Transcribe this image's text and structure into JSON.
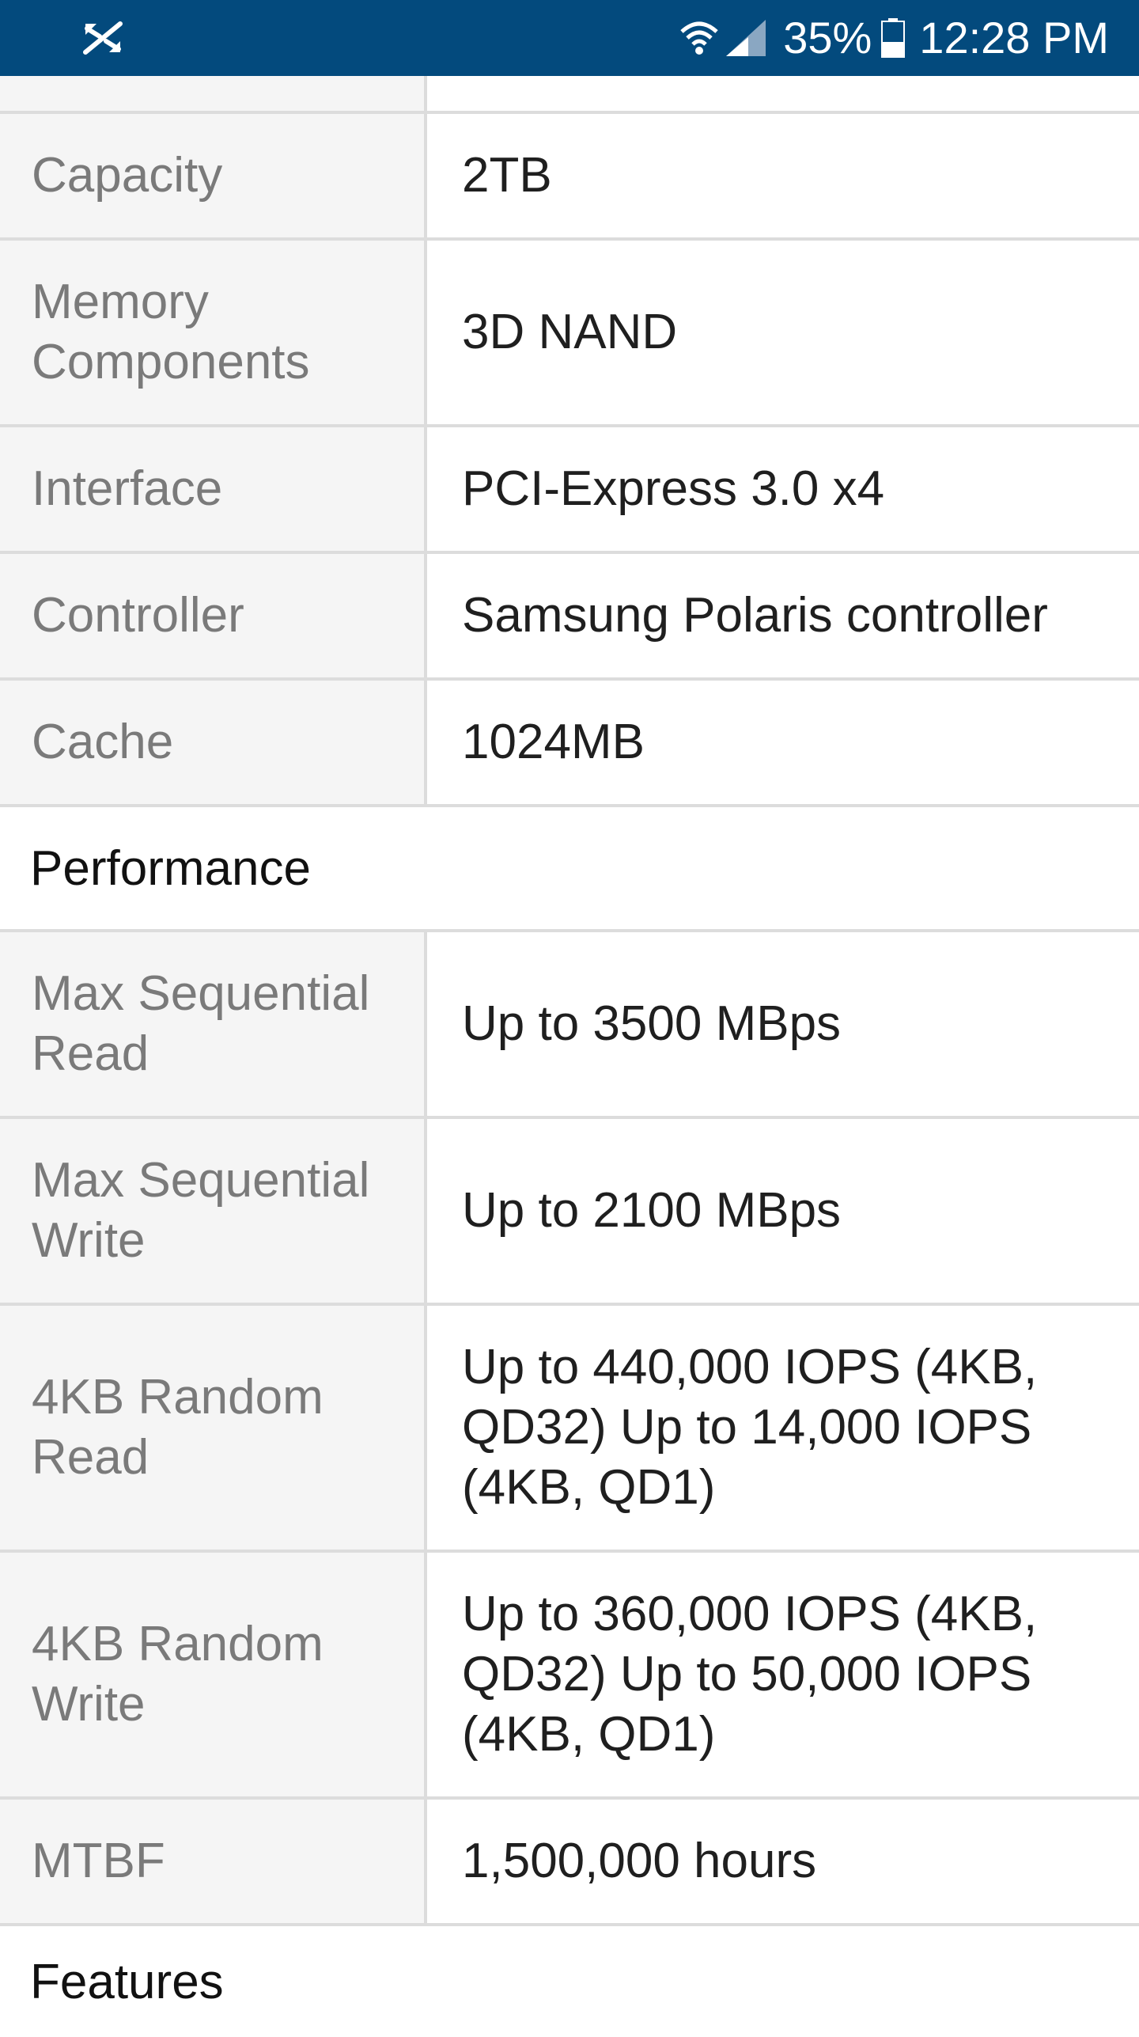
{
  "status_bar": {
    "battery_percent": "35%",
    "time": "12:28 PM",
    "icons": [
      "mute-sync-icon",
      "wifi-icon",
      "signal-icon",
      "battery-icon"
    ],
    "background": "#034a7d"
  },
  "specs": {
    "rows_group1": [
      {
        "label": "Capacity",
        "value": "2TB"
      },
      {
        "label": "Memory Components",
        "value": "3D NAND"
      },
      {
        "label": "Interface",
        "value": "PCI-Express 3.0 x4"
      },
      {
        "label": "Controller",
        "value": "Samsung Polaris controller"
      },
      {
        "label": "Cache",
        "value": "1024MB"
      }
    ],
    "section_performance": "Performance",
    "rows_performance": [
      {
        "label": "Max Sequential Read",
        "value": "Up to 3500 MBps"
      },
      {
        "label": "Max Sequential Write",
        "value": "Up to 2100 MBps"
      },
      {
        "label": "4KB Random Read",
        "value": "Up to 440,000 IOPS (4KB, QD32) Up to 14,000 IOPS (4KB, QD1)"
      },
      {
        "label": "4KB Random Write",
        "value": "Up to 360,000 IOPS (4KB, QD32) Up to 50,000 IOPS (4KB, QD1)"
      },
      {
        "label": "MTBF",
        "value": "1,500,000 hours"
      }
    ],
    "section_features": "Features"
  }
}
